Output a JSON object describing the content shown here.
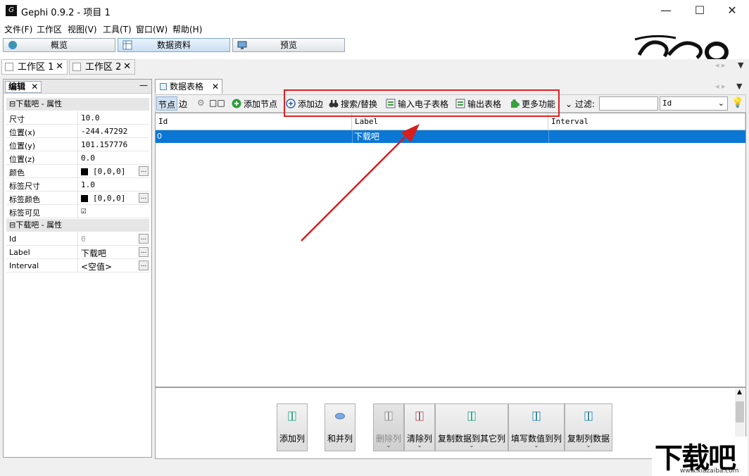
{
  "window": {
    "title": "Gephi 0.9.2 - 项目 1",
    "app_icon": "gephi-logo-icon",
    "controls": [
      "—",
      "☐",
      "✕"
    ]
  },
  "menu": [
    "文件(F)",
    "工作区",
    "视图(V)",
    "工具(T)",
    "窗口(W)",
    "帮助(H)"
  ],
  "modes": [
    {
      "label": "概览",
      "icon": "globe-icon",
      "active": false
    },
    {
      "label": "数据资料",
      "icon": "table-icon",
      "active": true
    },
    {
      "label": "预览",
      "icon": "monitor-icon",
      "active": false
    }
  ],
  "workspace_tabs": [
    {
      "label": "工作区 1",
      "close": "✕"
    },
    {
      "label": "工作区 2",
      "close": "✕"
    }
  ],
  "left_panel": {
    "tab": "编辑",
    "tab_close": "✕",
    "minimize": "—",
    "section1": "⊟下载吧 - 属性",
    "rows1": [
      {
        "name": "尺寸",
        "value": "10.0"
      },
      {
        "name": "位置(x)",
        "value": "-244.47292"
      },
      {
        "name": "位置(y)",
        "value": "101.157776"
      },
      {
        "name": "位置(z)",
        "value": "0.0"
      },
      {
        "name": "颜色",
        "value": "[0,0,0]"
      },
      {
        "name": "标签尺寸",
        "value": "1.0"
      },
      {
        "name": "标签颜色",
        "value": "[0,0,0]"
      },
      {
        "name": "标签可见",
        "value": "☑"
      }
    ],
    "section2": "⊟下载吧 - 属性",
    "rows2": [
      {
        "name": "Id",
        "value": "0"
      },
      {
        "name": "Label",
        "value": "下载吧"
      },
      {
        "name": "Interval",
        "value": "<空值>"
      }
    ],
    "ellipsis": "..."
  },
  "main": {
    "tab": "数据表格",
    "tab_close": "✕",
    "toolbar": {
      "nodes": "节点",
      "edges": "边",
      "add_node": "添加节点",
      "add_edge": "添加边",
      "search_replace": "搜索/替换",
      "import_spreadsheet": "输入电子表格",
      "export_table": "输出表格",
      "more": "更多功能",
      "filter_label": "过滤:",
      "filter_value": "",
      "filter_column": "Id",
      "filter_arrow": "⌄"
    },
    "table": {
      "columns": [
        "Id",
        "Label",
        "Interval"
      ],
      "rows": [
        [
          "0",
          "下载吧",
          ""
        ]
      ]
    },
    "actions": [
      {
        "label": "添加列",
        "enabled": true,
        "dropdown": false
      },
      {
        "label": "和并列",
        "enabled": true,
        "dropdown": false
      },
      {
        "label": "删除列",
        "enabled": false,
        "dropdown": true
      },
      {
        "label": "清除列",
        "enabled": true,
        "dropdown": true
      },
      {
        "label": "复制数据到其它列",
        "enabled": true,
        "dropdown": true
      },
      {
        "label": "填写数值到列",
        "enabled": true,
        "dropdown": true
      },
      {
        "label": "复制列数据",
        "enabled": true,
        "dropdown": true
      }
    ]
  },
  "watermark": {
    "text": "下载吧",
    "url": "www.xiazaiba.com"
  },
  "colors": {
    "selection": "#0a77d5",
    "highlight_box": "#e02020",
    "arrow": "#d81e1e"
  }
}
